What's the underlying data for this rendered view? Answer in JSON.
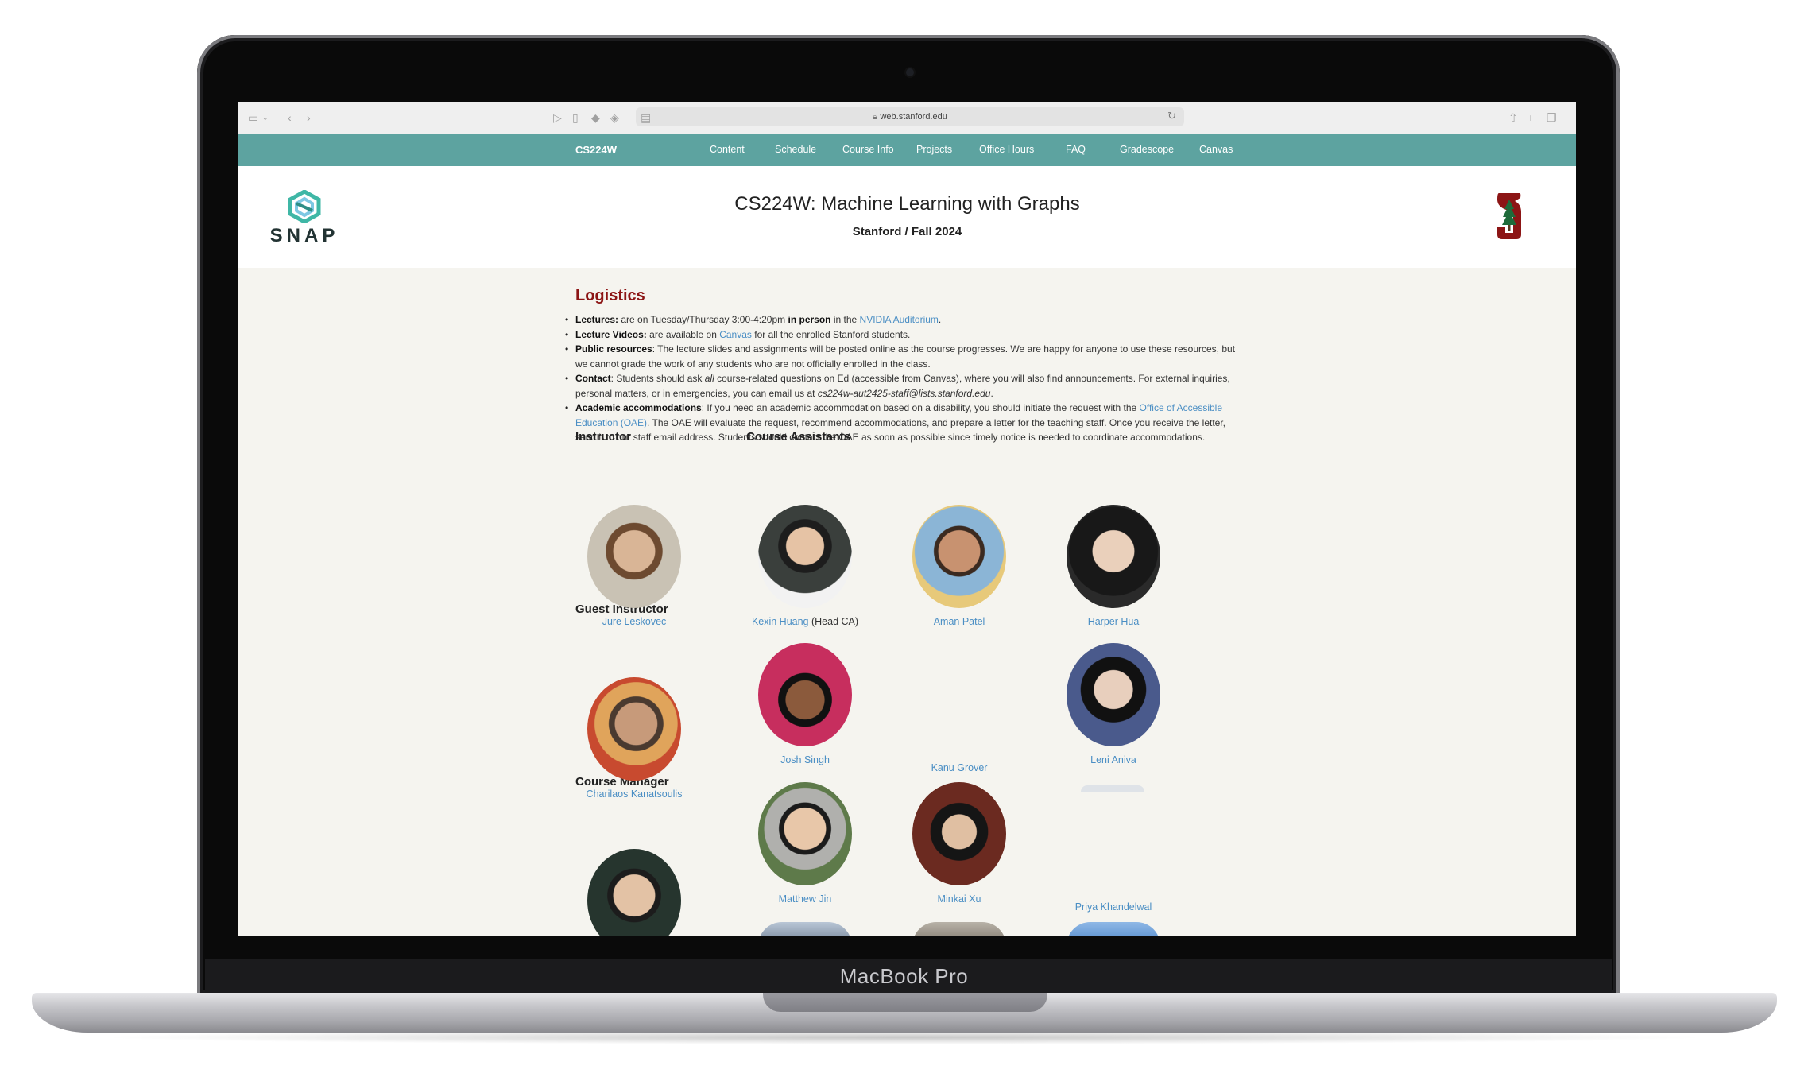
{
  "device": {
    "label": "MacBook Pro"
  },
  "browser": {
    "url": "web.stanford.edu"
  },
  "nav": {
    "brand": "CS224W",
    "links": [
      "Content",
      "Schedule",
      "Course Info",
      "Projects",
      "Office Hours",
      "FAQ",
      "Gradescope",
      "Canvas"
    ]
  },
  "header": {
    "logo_text": "SNAP",
    "title": "CS224W: Machine Learning with Graphs",
    "subtitle": "Stanford / Fall 2024"
  },
  "logistics": {
    "title": "Logistics",
    "lectures": {
      "label": "Lectures:",
      "t1": " are on Tuesday/Thursday 3:00-4:20pm ",
      "bold": "in person",
      "t2": " in the ",
      "link": "NVIDIA Auditorium",
      "t3": "."
    },
    "videos": {
      "label": "Lecture Videos:",
      "t1": " are available on ",
      "link": "Canvas",
      "t2": " for all the enrolled Stanford students."
    },
    "public": {
      "label": "Public resources",
      "text": ": The lecture slides and assignments will be posted online as the course progresses. We are happy for anyone to use these resources, but we cannot grade the work of any students who are not officially enrolled in the class."
    },
    "contact": {
      "label": "Contact",
      "t1": ": Students should ask ",
      "em": "all",
      "t2": " course-related questions on Ed (accessible from Canvas), where you will also find announcements. For external inquiries, personal matters, or in emergencies, you can email us at ",
      "email": "cs224w-aut2425-staff@lists.stanford.edu",
      "t3": "."
    },
    "accommodations": {
      "label": "Academic accommodations",
      "t1": ": If you need an academic accommodation based on a disability, you should initiate the request with the ",
      "link": "Office of Accessible Education (OAE)",
      "t2": ". The OAE will evaluate the request, recommend accommodations, and prepare a letter for the teaching staff. Once you receive the letter, send it to our staff email address. Students should contact the OAE as soon as possible since timely notice is needed to coordinate accommodations."
    }
  },
  "staff": {
    "instructor_title": "Instructor",
    "instructor": "Jure Leskovec",
    "guest_title": "Guest Instructor",
    "guest": "Charilaos Kanatsoulis",
    "manager_title": "Course Manager",
    "ca_title": "Course Assistants",
    "cas": {
      "kexin": "Kexin Huang",
      "kexin_role": " (Head CA)",
      "aman": "Aman Patel",
      "harper": "Harper Hua",
      "josh": "Josh Singh",
      "kanu": "Kanu Grover",
      "leni": "Leni Aniva",
      "matthew": "Matthew Jin",
      "minkai": "Minkai Xu",
      "priya": "Priya Khandelwal"
    }
  }
}
